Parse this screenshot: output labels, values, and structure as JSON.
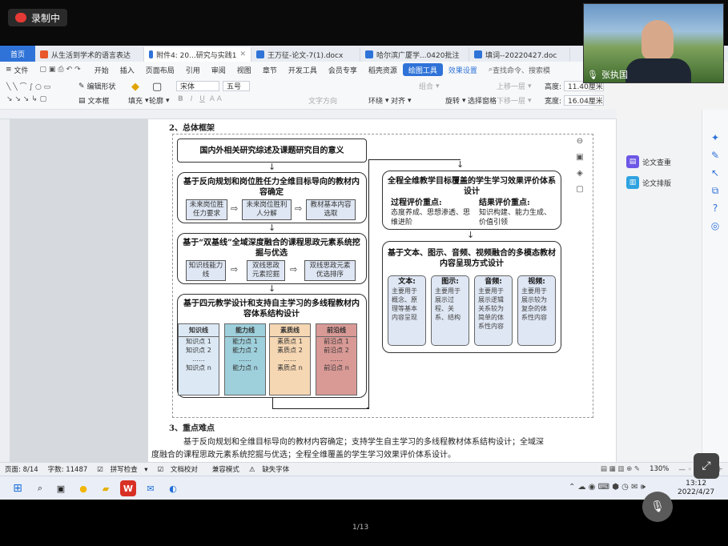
{
  "recording": {
    "label": "录制中"
  },
  "video": {
    "name": "张执国"
  },
  "tabs": [
    {
      "label": "首页",
      "kind": "home"
    },
    {
      "label": "从生活到学术的语言表达",
      "color": "#e8582c"
    },
    {
      "label": "附件4: 20...研究与实践1",
      "color": "#2f73d8",
      "active": true
    },
    {
      "label": "王万征-论文-7(1).docx",
      "color": "#2f73d8"
    },
    {
      "label": "哈尔滨广厦学...0420批注",
      "color": "#2f73d8"
    },
    {
      "label": "填词--20220427.doc",
      "color": "#2f73d8"
    }
  ],
  "menubar": {
    "file": "文件",
    "items": [
      "开始",
      "插入",
      "页面布局",
      "引用",
      "审阅",
      "视图",
      "章节",
      "开发工具",
      "会员专享",
      "稻壳资源"
    ],
    "active": "绘图工具",
    "effects": "效果设置",
    "search": "查找命令、搜索模"
  },
  "ribbon": {
    "edit_shape": "编辑形状",
    "text_box": "文本框",
    "fill": "填充",
    "outline": "轮廓",
    "font": "宋体",
    "size": "五号",
    "text_effect": "文字方向",
    "wrap": "环绕",
    "align": "对齐",
    "group": "组合",
    "rotate": "旋转",
    "select_pane": "选择窗格",
    "up_layer": "上移一层",
    "down_layer": "下移一层",
    "height_label": "高度:",
    "height_value": "11.40厘米",
    "width_label": "宽度:",
    "width_value": "16.04厘米"
  },
  "side_panel": {
    "check": "论文查重",
    "layout": "论文排版"
  },
  "doc": {
    "top_heading": "2、总体框架",
    "left1": "国内外相关研究综述及课题研究目的意义",
    "left2_title": "基于反向规划和岗位胜任力全维目标导向的教材内容确定",
    "left2_items": [
      "未来岗位胜任力要求",
      "未来岗位胜利人分解",
      "教材基本内容选取"
    ],
    "left3_title": "基于“双基线”全域深度融合的课程思政元素系统挖掘与优选",
    "left3_items": [
      "知识线能力线",
      "双线思政元素挖掘",
      "双线思政元素优选排序"
    ],
    "left4_title": "基于四元教学设计和支持自主学习的多线程教材内容体系结构设计",
    "left4_cols": [
      {
        "head": "知识线",
        "rows": [
          "知识点 1",
          "知识点 2",
          "……",
          "知识点 n"
        ],
        "color": "#dce9f5"
      },
      {
        "head": "能力线",
        "rows": [
          "能力点 1",
          "能力点 2",
          "……",
          "能力点 n"
        ],
        "color": "#9ed0dc"
      },
      {
        "head": "素质线",
        "rows": [
          "素质点 1",
          "素质点 2",
          "……",
          "素质点 n"
        ],
        "color": "#f6d7b3"
      },
      {
        "head": "前沿线",
        "rows": [
          "前沿点 1",
          "前沿点 2",
          "……",
          "前沿点 n"
        ],
        "color": "#d99a96"
      }
    ],
    "right1_title": "全程全维教学目标覆盖的学生学习效果评价体系设计",
    "right1_proc_head": "过程评价重点:",
    "right1_proc_body": "态度养成、思想渗透、思维进阶",
    "right1_res_head": "结果评价重点:",
    "right1_res_body": "知识构建、能力生成、价值引领",
    "right2_title": "基于文本、图示、音频、视频融合的多模态教材内容呈现方式设计",
    "right2_cols": [
      {
        "head": "文本:",
        "body": "主要用于概念、原理等基本内容呈现"
      },
      {
        "head": "图示:",
        "body": "主要用于展示过程、关系、结构"
      },
      {
        "head": "音频:",
        "body": "主要用于展示逻辑关系较为简单的体系性内容"
      },
      {
        "head": "视频:",
        "body": "主要用于展示较为复杂的体系性内容"
      }
    ],
    "section3": "3、重点难点",
    "para1": "基于反向规划和全维目标导向的教材内容确定；支持学生自主学习的多线程教材体系结构设计；全域深",
    "para2": "度融合的课程思政元素系统挖掘与优选；全程全维覆盖的学生学习效果评价体系设计。"
  },
  "status": {
    "page": "页面: 8/14",
    "words": "字数: 11487",
    "spell": "拼写检查",
    "proof": "文档校对",
    "compat": "兼容模式",
    "missing_font": "缺失字体",
    "zoom": "130%"
  },
  "clock": {
    "time": "13:12",
    "date": "2022/4/27"
  },
  "pager": "1/13"
}
